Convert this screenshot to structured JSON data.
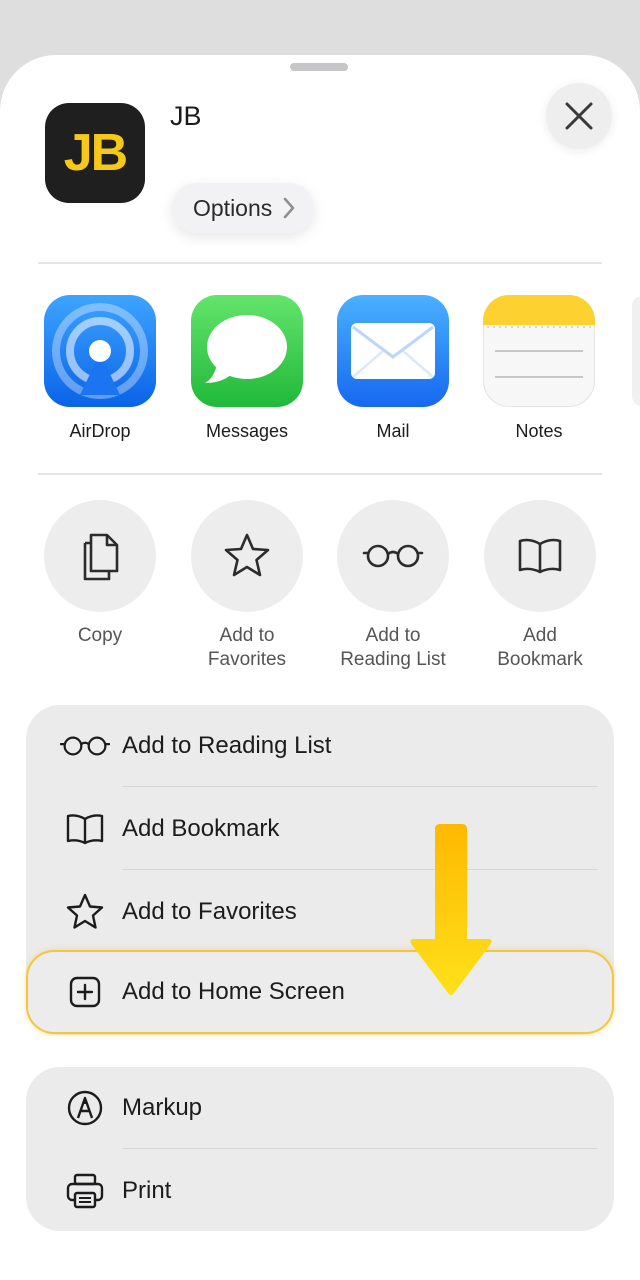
{
  "header": {
    "app_icon_text": "JB",
    "title": "JB",
    "options_label": "Options"
  },
  "apps": [
    {
      "label": "AirDrop",
      "icon": "airdrop-icon"
    },
    {
      "label": "Messages",
      "icon": "messages-icon"
    },
    {
      "label": "Mail",
      "icon": "mail-icon"
    },
    {
      "label": "Notes",
      "icon": "notes-icon"
    }
  ],
  "actions": [
    {
      "line1": "Copy",
      "line2": "",
      "icon": "copy-icon"
    },
    {
      "line1": "Add to",
      "line2": "Favorites",
      "icon": "star-icon"
    },
    {
      "line1": "Add to",
      "line2": "Reading List",
      "icon": "glasses-icon"
    },
    {
      "line1": "Add",
      "line2": "Bookmark",
      "icon": "book-icon"
    }
  ],
  "menu_group_1": [
    {
      "label": "Add to Reading List",
      "icon": "glasses-icon"
    },
    {
      "label": "Add Bookmark",
      "icon": "book-icon"
    },
    {
      "label": "Add to Favorites",
      "icon": "star-icon"
    },
    {
      "label": "Add to Home Screen",
      "icon": "plus-square-icon"
    }
  ],
  "menu_group_2": [
    {
      "label": "Markup",
      "icon": "markup-icon"
    },
    {
      "label": "Print",
      "icon": "printer-icon"
    }
  ],
  "colors": {
    "highlight": "#f5c542",
    "arrow": "#ffc400",
    "app_icon_bg": "#1f1f1f",
    "app_icon_text": "#f6c919"
  }
}
